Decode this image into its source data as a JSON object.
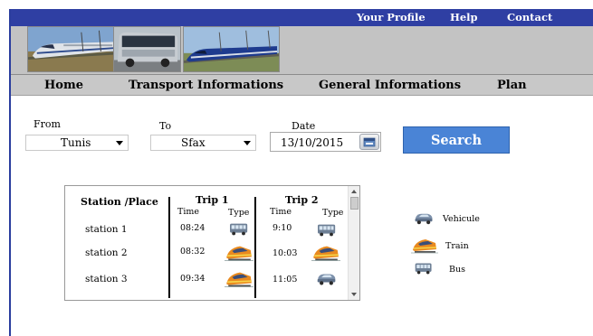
{
  "top_nav": {
    "profile": "Your Profile",
    "help": "Help",
    "contact": "Contact"
  },
  "main_nav": {
    "home": "Home",
    "transport": "Transport Informations",
    "general": "General Informations",
    "plan": "Plan"
  },
  "search_form": {
    "from_label": "From",
    "from_value": "Tunis",
    "to_label": "To",
    "to_value": "Sfax",
    "date_label": "Date",
    "date_value": "13/10/2015",
    "search_label": "Search"
  },
  "table": {
    "station_header": "Station /Place",
    "trip1_header": "Trip 1",
    "trip2_header": "Trip 2",
    "time_header": "Time",
    "type_header": "Type",
    "rows": [
      {
        "station": "station 1",
        "trip1_time": "08:24",
        "trip1_type": "bus-icon",
        "trip2_time": "9:10",
        "trip2_type": "bus-icon"
      },
      {
        "station": "station 2",
        "trip1_time": "08:32",
        "trip1_type": "train-icon",
        "trip2_time": "10:03",
        "trip2_type": "train-icon"
      },
      {
        "station": "station 3",
        "trip1_time": "09:34",
        "trip1_type": "train-icon",
        "trip2_time": "11:05",
        "trip2_type": "vehicle-icon"
      }
    ]
  },
  "legend": [
    {
      "label": "Vehicule",
      "icon": "vehicle-icon"
    },
    {
      "label": "Train",
      "icon": "train-icon"
    },
    {
      "label": "Bus",
      "icon": "bus-icon"
    }
  ],
  "colors": {
    "top_bar": "#2f3fa3",
    "nav_bar": "#c8c8c8",
    "search_button": "#4a84d6",
    "photo_band": "#c3c3c3"
  }
}
